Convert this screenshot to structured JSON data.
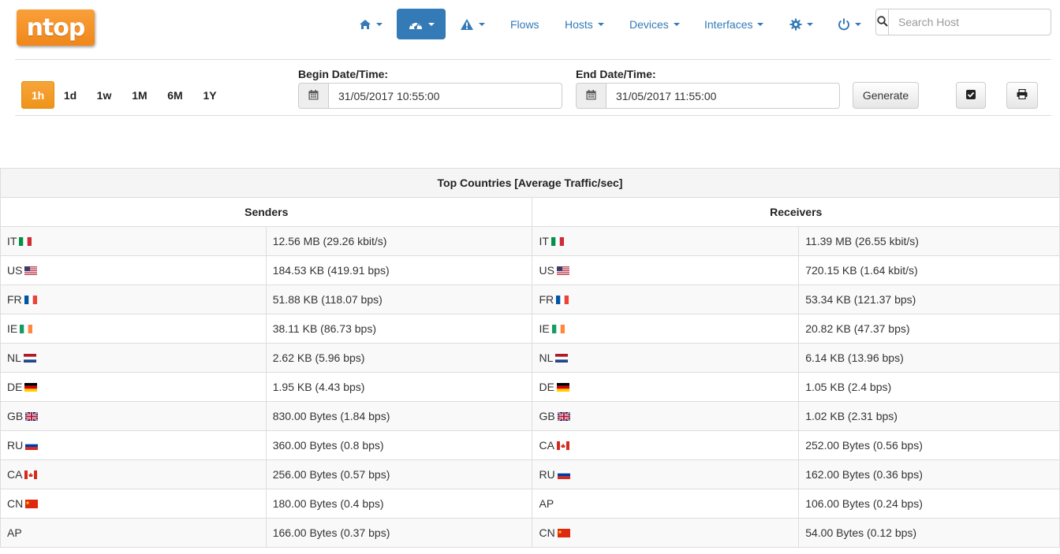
{
  "brand": {
    "logo_text": "ntop"
  },
  "nav": {
    "items": [
      {
        "name": "home",
        "icon": "home-icon",
        "label": ""
      },
      {
        "name": "dashboard",
        "icon": "dashboard-icon",
        "label": ""
      },
      {
        "name": "alerts",
        "icon": "warning-icon",
        "label": ""
      },
      {
        "name": "flows",
        "label": "Flows"
      },
      {
        "name": "hosts",
        "label": "Hosts"
      },
      {
        "name": "devices",
        "label": "Devices"
      },
      {
        "name": "interfaces",
        "label": "Interfaces"
      },
      {
        "name": "settings",
        "icon": "gear-icon",
        "label": ""
      },
      {
        "name": "power",
        "icon": "power-icon",
        "label": ""
      }
    ],
    "active_item": "dashboard",
    "search": {
      "placeholder": "Search Host",
      "icon": "search-icon"
    }
  },
  "time_range": {
    "buttons": [
      "1h",
      "1d",
      "1w",
      "1M",
      "6M",
      "1Y"
    ],
    "active": "1h",
    "begin_label": "Begin Date/Time:",
    "begin_value": "31/05/2017 10:55:00",
    "end_label": "End Date/Time:",
    "end_value": "31/05/2017 11:55:00",
    "generate_label": "Generate",
    "calendar_icon": "calendar-icon",
    "extra_buttons": [
      "checkbox-icon",
      "print-icon"
    ]
  },
  "table": {
    "title": "Top Countries [Average Traffic/sec]",
    "senders_header": "Senders",
    "receivers_header": "Receivers",
    "rows": [
      {
        "s_code": "IT",
        "s_flag": "it",
        "s_value": "12.56 MB (29.26 kbit/s)",
        "r_code": "IT",
        "r_flag": "it",
        "r_value": "11.39 MB (26.55 kbit/s)"
      },
      {
        "s_code": "US",
        "s_flag": "us",
        "s_value": "184.53 KB (419.91 bps)",
        "r_code": "US",
        "r_flag": "us",
        "r_value": "720.15 KB (1.64 kbit/s)"
      },
      {
        "s_code": "FR",
        "s_flag": "fr",
        "s_value": "51.88 KB (118.07 bps)",
        "r_code": "FR",
        "r_flag": "fr",
        "r_value": "53.34 KB (121.37 bps)"
      },
      {
        "s_code": "IE",
        "s_flag": "ie",
        "s_value": "38.11 KB (86.73 bps)",
        "r_code": "IE",
        "r_flag": "ie",
        "r_value": "20.82 KB (47.37 bps)"
      },
      {
        "s_code": "NL",
        "s_flag": "nl",
        "s_value": "2.62 KB (5.96 bps)",
        "r_code": "NL",
        "r_flag": "nl",
        "r_value": "6.14 KB (13.96 bps)"
      },
      {
        "s_code": "DE",
        "s_flag": "de",
        "s_value": "1.95 KB (4.43 bps)",
        "r_code": "DE",
        "r_flag": "de",
        "r_value": "1.05 KB (2.4 bps)"
      },
      {
        "s_code": "GB",
        "s_flag": "gb",
        "s_value": "830.00 Bytes (1.84 bps)",
        "r_code": "GB",
        "r_flag": "gb",
        "r_value": "1.02 KB (2.31 bps)"
      },
      {
        "s_code": "RU",
        "s_flag": "ru",
        "s_value": "360.00 Bytes (0.8 bps)",
        "r_code": "CA",
        "r_flag": "ca",
        "r_value": "252.00 Bytes (0.56 bps)"
      },
      {
        "s_code": "CA",
        "s_flag": "ca",
        "s_value": "256.00 Bytes (0.57 bps)",
        "r_code": "RU",
        "r_flag": "ru",
        "r_value": "162.00 Bytes (0.36 bps)"
      },
      {
        "s_code": "CN",
        "s_flag": "cn",
        "s_value": "180.00 Bytes (0.4 bps)",
        "r_code": "AP",
        "r_flag": "",
        "r_value": "106.00 Bytes (0.24 bps)"
      },
      {
        "s_code": "AP",
        "s_flag": "",
        "s_value": "166.00 Bytes (0.37 bps)",
        "r_code": "CN",
        "r_flag": "cn",
        "r_value": "54.00 Bytes (0.12 bps)"
      }
    ]
  }
}
